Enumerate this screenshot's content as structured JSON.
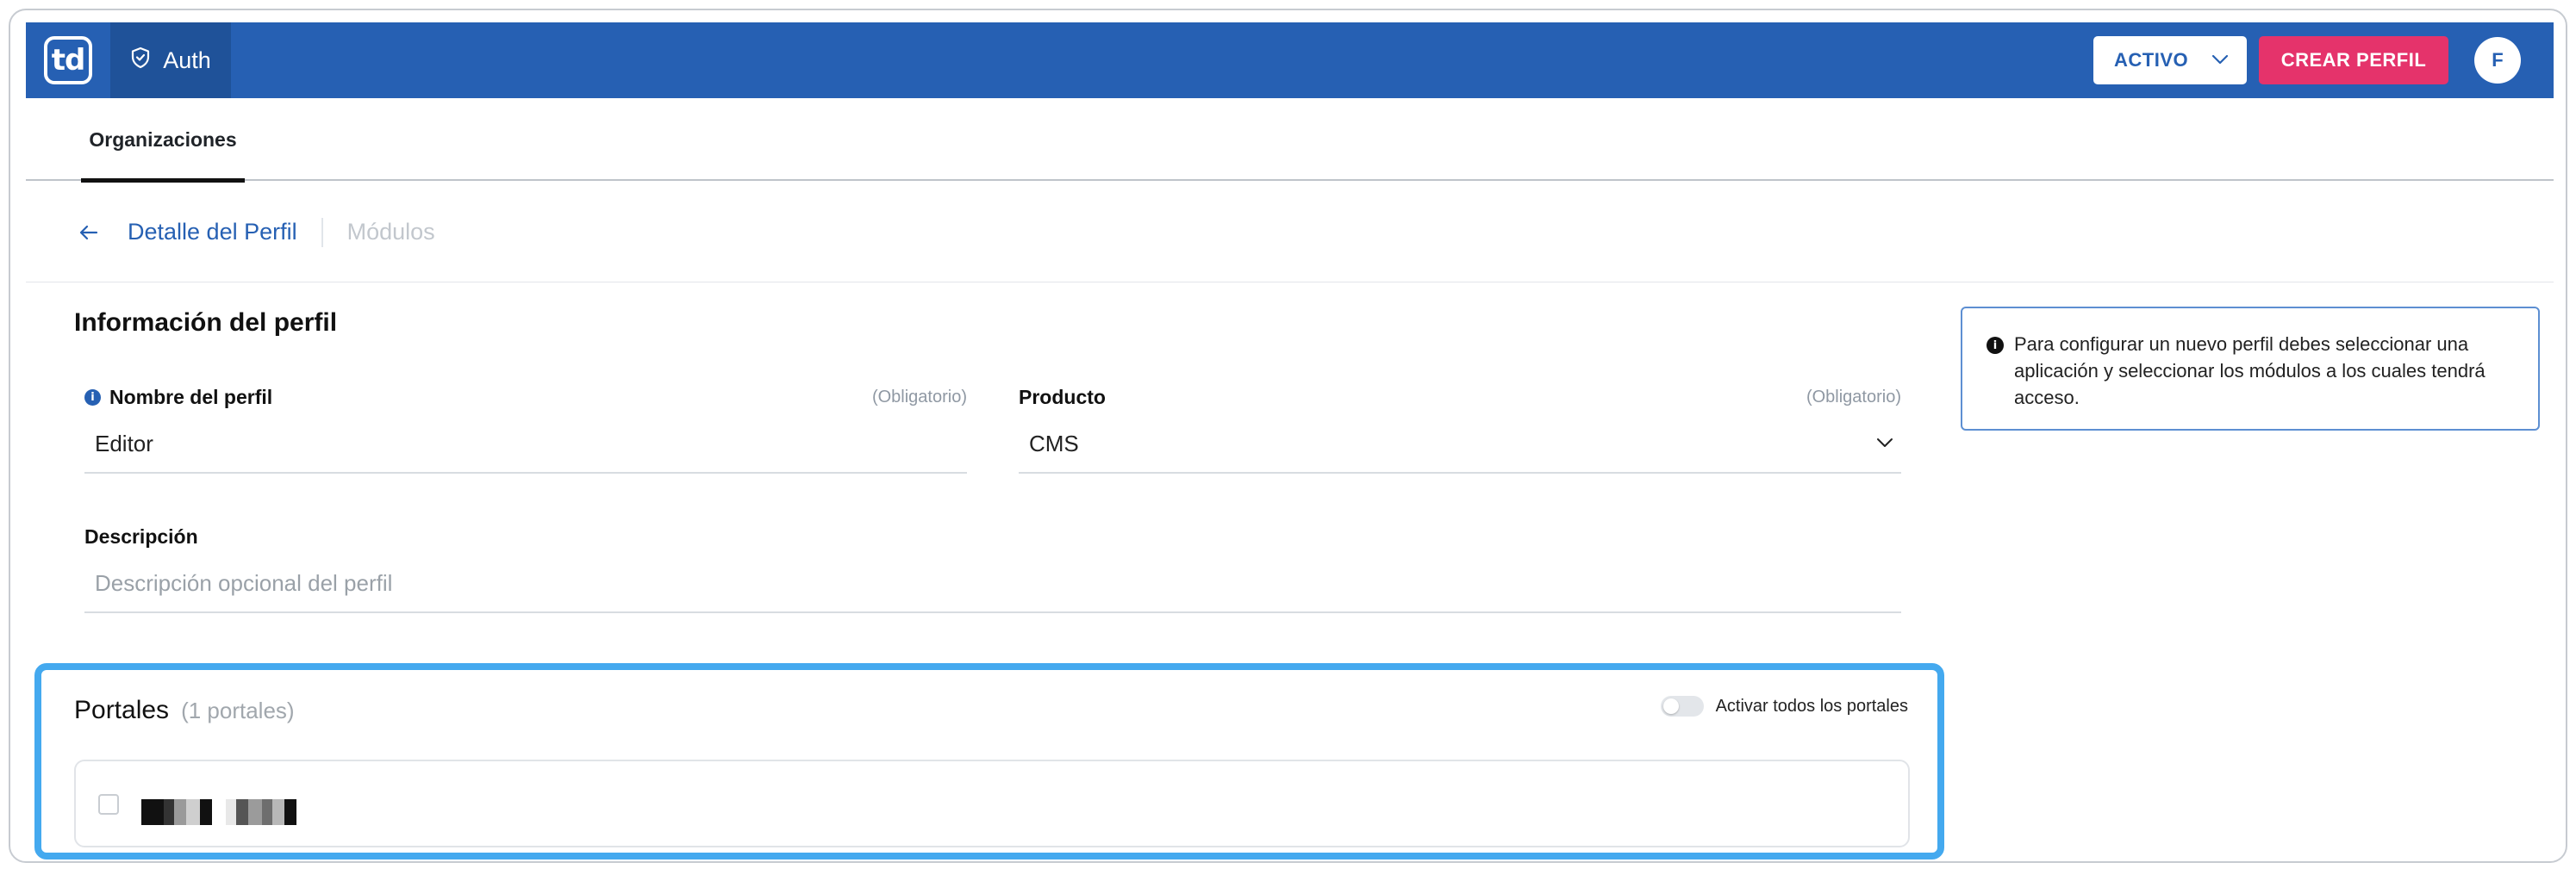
{
  "header": {
    "logo_text": "td",
    "app_name": "Auth",
    "status_value": "ACTIVO",
    "create_button": "CREAR PERFIL",
    "avatar_initial": "F"
  },
  "tabs": [
    {
      "label": "Organizaciones",
      "active": true
    }
  ],
  "breadcrumb": {
    "current": "Detalle del Perfil",
    "next": "Módulos"
  },
  "profile": {
    "section_title": "Información del perfil",
    "name_label": "Nombre del perfil",
    "name_required": "(Obligatorio)",
    "name_value": "Editor",
    "product_label": "Producto",
    "product_required": "(Obligatorio)",
    "product_value": "CMS",
    "description_label": "Descripción",
    "description_placeholder": "Descripción opcional del perfil"
  },
  "info_box": {
    "text": "Para configurar un nuevo perfil debes seleccionar una aplicación y seleccionar los módulos a los cuales tendrá acceso."
  },
  "portales": {
    "title": "Portales",
    "count": "(1 portales)",
    "toggle_label": "Activar todos los portales"
  },
  "colors": {
    "primary": "#2660b3",
    "primary_dark": "#1f5299",
    "accent": "#e5336b",
    "highlight": "#44a9ef"
  },
  "icons": {
    "app": "shield-check-icon",
    "dropdown": "chevron-down-icon",
    "back": "arrow-left-icon",
    "info": "info-icon"
  }
}
